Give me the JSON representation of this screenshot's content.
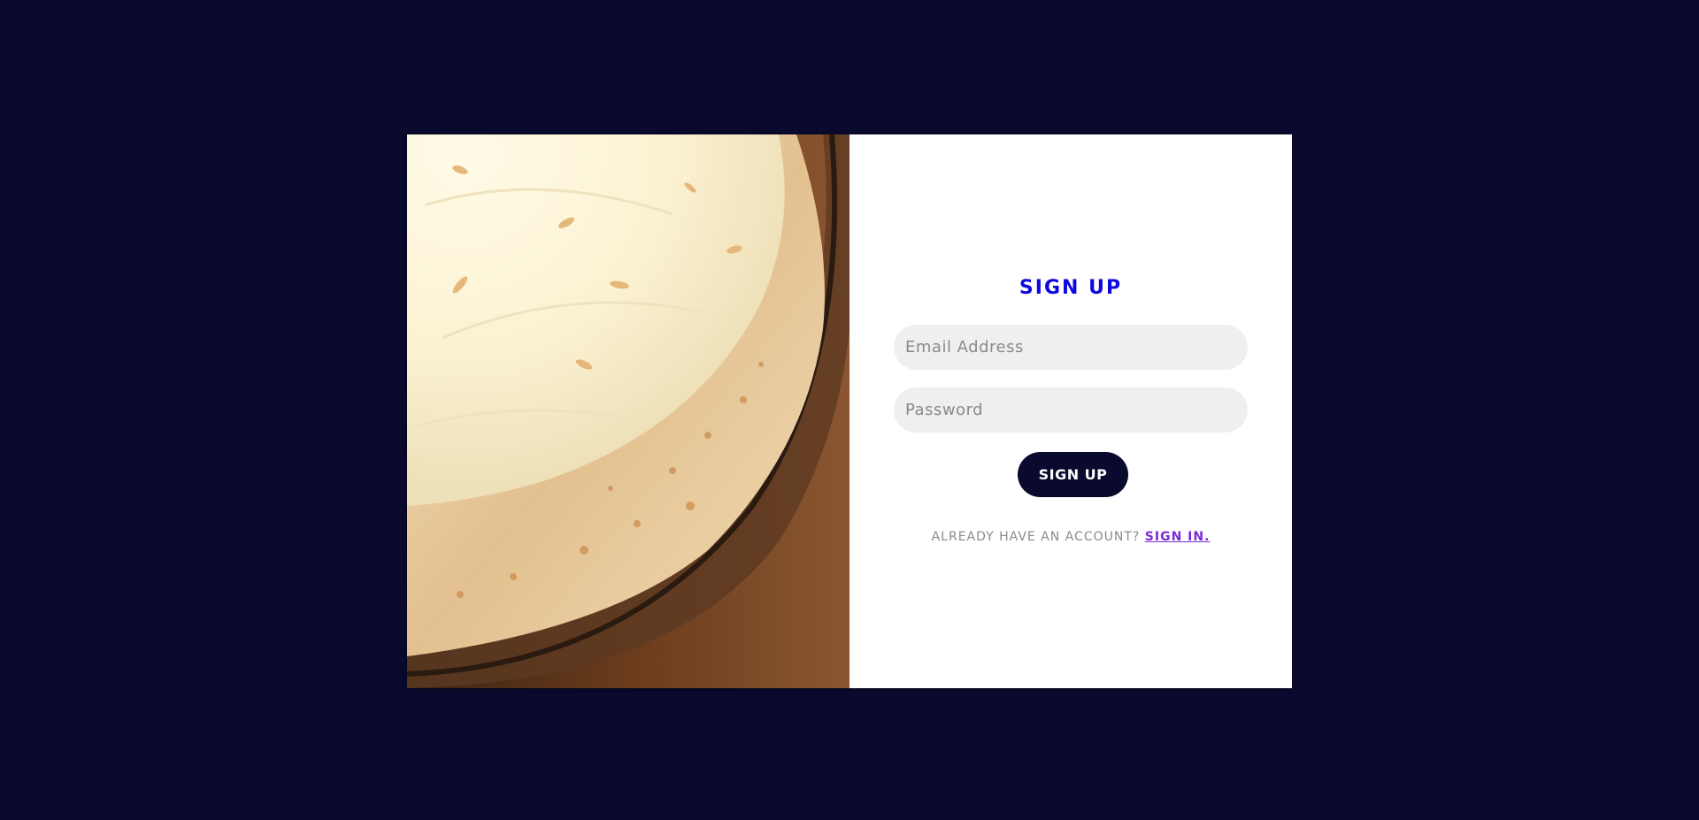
{
  "form": {
    "title": "SIGN UP",
    "email_placeholder": "Email Address",
    "password_placeholder": "Password",
    "submit_label": "SIGN UP",
    "switch_prompt": "ALREADY HAVE AN ACCOUNT? ",
    "switch_link": "SIGN IN."
  },
  "colors": {
    "background": "#090a2e",
    "title": "#0d08e0",
    "button": "#090a2e",
    "link": "#7a2bd8",
    "field": "#efefef"
  }
}
